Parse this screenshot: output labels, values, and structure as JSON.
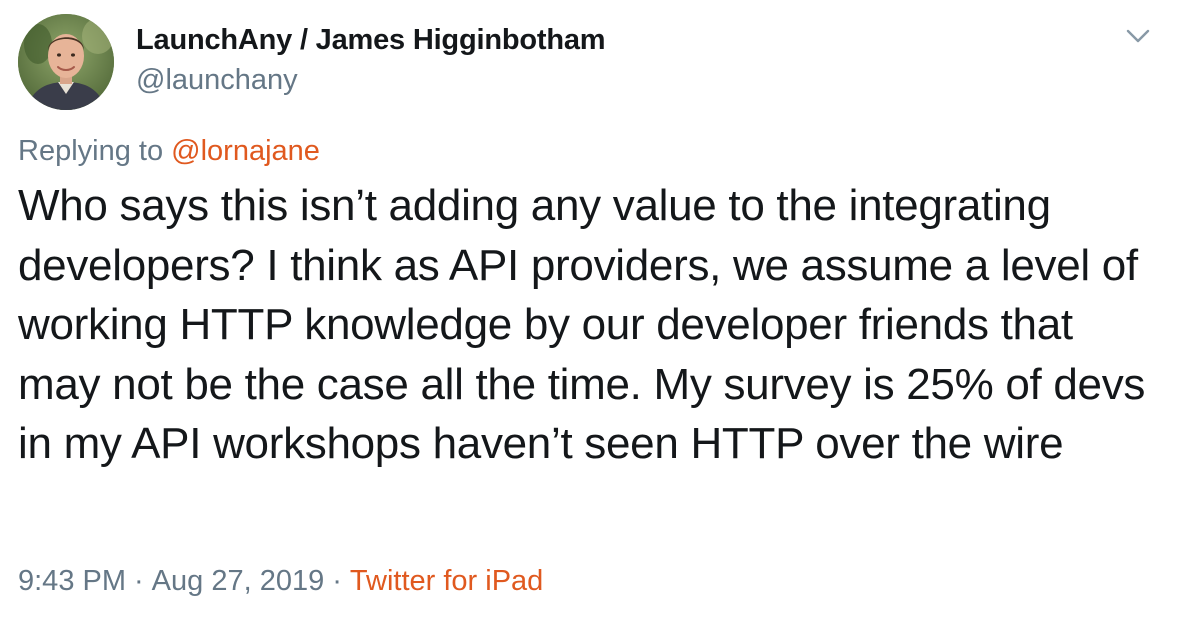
{
  "author": {
    "display_name": "LaunchAny / James Higginbotham",
    "handle": "@launchany"
  },
  "header": {
    "menu_icon": "chevron-down-icon"
  },
  "reply": {
    "prefix": "Replying to ",
    "mention": "@lornajane"
  },
  "tweet": {
    "text": "Who says this isn’t adding any value to the integrating developers? I think as API providers, we assume a level of working HTTP knowledge by our developer friends that may not be the case all the time. My survey is 25% of devs in my API workshops haven’t seen HTTP over the wire"
  },
  "meta": {
    "time": "9:43 PM",
    "separator": "·",
    "date": "Aug 27, 2019",
    "source": "Twitter for iPad"
  },
  "colors": {
    "accent": "#e0591f",
    "secondary_text": "#657786",
    "primary_text": "#14171a"
  }
}
